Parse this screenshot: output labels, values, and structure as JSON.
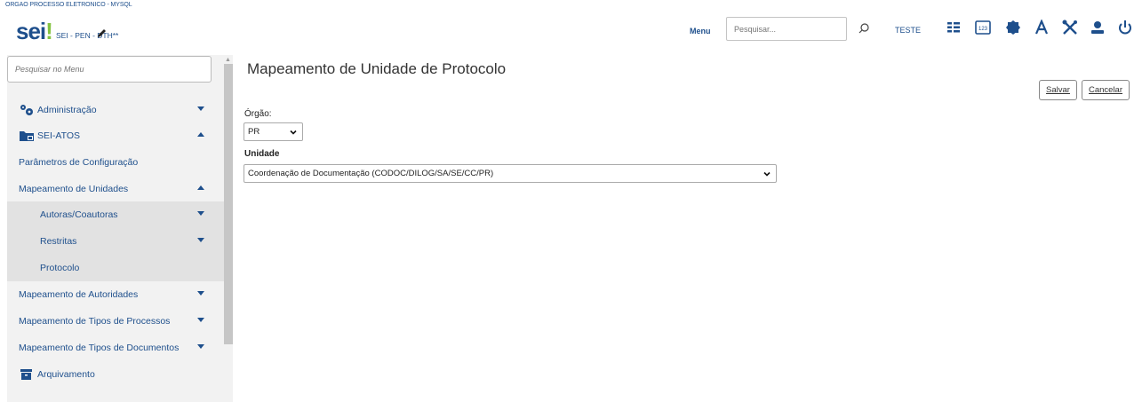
{
  "header": {
    "org_name": "ORGAO PROCESSO ELETRONICO - MYSQL",
    "logo_text": "sei",
    "logo_bang": "!",
    "system_name": "SEI - PEN - DTH**",
    "menu_label": "Menu",
    "search_placeholder": "Pesquisar...",
    "unit_label": "TESTE",
    "icons": [
      "edit-pen-icon",
      "search-icon",
      "grid-list-icon",
      "keypad-123-icon",
      "badge-icon",
      "font-size-icon",
      "tools-icon",
      "user-icon",
      "power-icon"
    ]
  },
  "sidebar": {
    "search_placeholder": "Pesquisar no Menu",
    "items": [
      {
        "label": "Administração",
        "icon": "gears-icon",
        "caret": "down"
      },
      {
        "label": "SEI-ATOS",
        "icon": "folder-icon",
        "caret": "up"
      },
      {
        "label": "Parâmetros de Configuração"
      },
      {
        "label": "Mapeamento de Unidades",
        "caret": "up"
      },
      {
        "label": "Autoras/Coautoras",
        "caret": "down"
      },
      {
        "label": "Restritas",
        "caret": "down"
      },
      {
        "label": "Protocolo"
      },
      {
        "label": "Mapeamento de Autoridades",
        "caret": "down"
      },
      {
        "label": "Mapeamento de Tipos de Processos",
        "caret": "down"
      },
      {
        "label": "Mapeamento de Tipos de Documentos",
        "caret": "down"
      },
      {
        "label": "Arquivamento",
        "icon": "archive-icon"
      }
    ]
  },
  "main": {
    "title": "Mapeamento de Unidade de Protocolo",
    "save_label": "Salvar",
    "cancel_label": "Cancelar",
    "orgao_label": "Órgão:",
    "orgao_value": "PR",
    "unidade_label": "Unidade",
    "unidade_value": "Coordenação de Documentação (CODOC/DILOG/SA/SE/CC/PR)"
  },
  "colors": {
    "brand_blue": "#1e4f8c",
    "brand_green": "#84c341"
  }
}
